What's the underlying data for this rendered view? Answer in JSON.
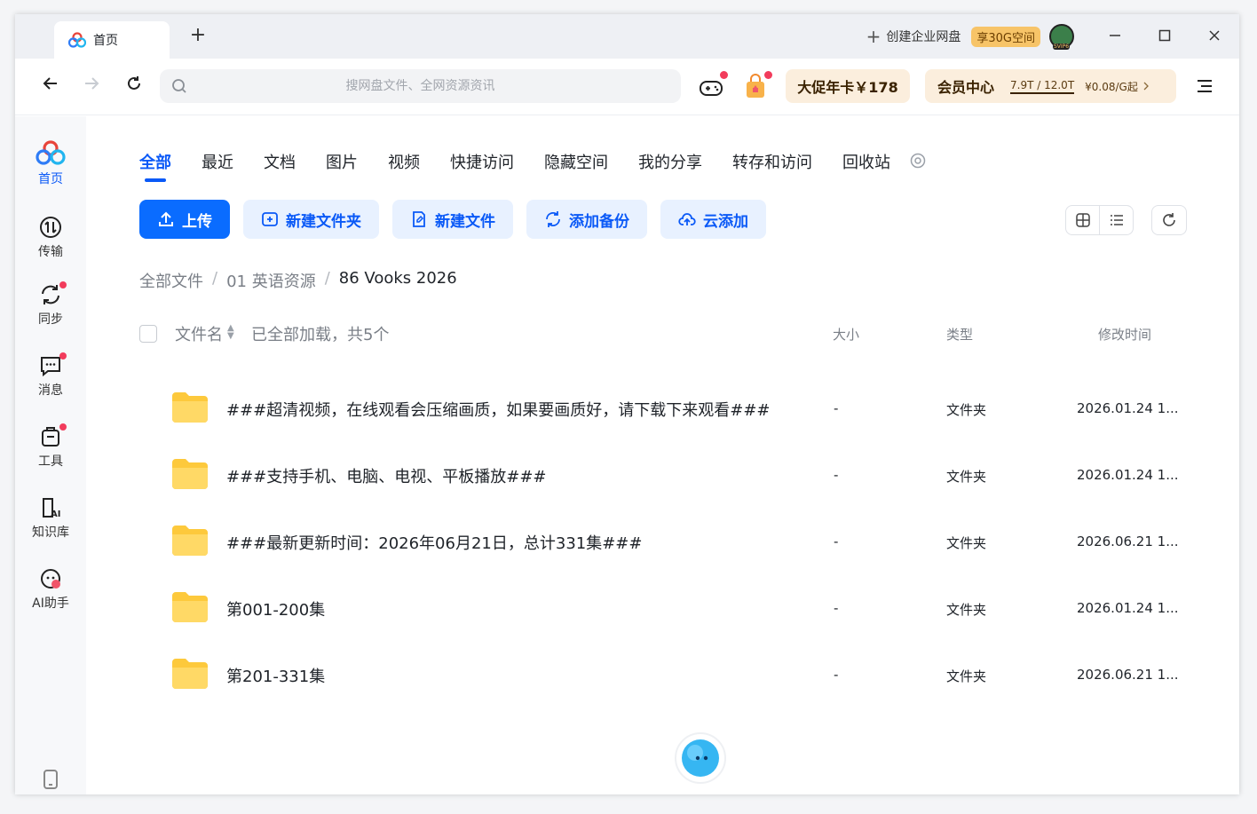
{
  "titlebar": {
    "tab_label": "首页",
    "new_tab": "+",
    "create_enterprise": "创建企业网盘",
    "space_badge": "享30G空间",
    "avatar_label": "SVIP6"
  },
  "toolbar": {
    "search_placeholder": "搜网盘文件、全网资源资讯",
    "promo_label": "大促年卡￥178",
    "vip_title": "会员中心",
    "vip_quota": "7.9T / 12.0T",
    "vip_price": "¥0.08/G起"
  },
  "sidebar": {
    "items": [
      {
        "label": "首页",
        "icon": "logo-icon"
      },
      {
        "label": "传输",
        "icon": "transfer-icon"
      },
      {
        "label": "同步",
        "icon": "sync-icon"
      },
      {
        "label": "消息",
        "icon": "message-icon"
      },
      {
        "label": "工具",
        "icon": "toolbox-icon"
      },
      {
        "label": "知识库",
        "icon": "knowledge-base-icon"
      },
      {
        "label": "AI助手",
        "icon": "ai-assistant-icon"
      }
    ]
  },
  "categories": [
    "全部",
    "最近",
    "文档",
    "图片",
    "视频",
    "快捷访问",
    "隐藏空间",
    "我的分享",
    "转存和访问",
    "回收站"
  ],
  "actions": {
    "upload": "上传",
    "new_folder": "新建文件夹",
    "new_file": "新建文件",
    "add_backup": "添加备份",
    "cloud_add": "云添加"
  },
  "breadcrumb": [
    "全部文件",
    "01 英语资源",
    "86 Vooks 2026"
  ],
  "table": {
    "col_name": "文件名",
    "loaded_status": "已全部加载，共5个",
    "col_size": "大小",
    "col_type": "类型",
    "col_time": "修改时间",
    "rows": [
      {
        "name": "###超清视频，在线观看会压缩画质，如果要画质好，请下载下来观看###",
        "size": "-",
        "type": "文件夹",
        "time": "2026.01.24 1..."
      },
      {
        "name": "###支持手机、电脑、电视、平板播放###",
        "size": "-",
        "type": "文件夹",
        "time": "2026.01.24 1..."
      },
      {
        "name": "###最新更新时间：2026年06月21日，总计331集###",
        "size": "-",
        "type": "文件夹",
        "time": "2026.06.21 1..."
      },
      {
        "name": "第001-200集",
        "size": "-",
        "type": "文件夹",
        "time": "2026.01.24 1..."
      },
      {
        "name": "第201-331集",
        "size": "-",
        "type": "文件夹",
        "time": "2026.06.21 1..."
      }
    ]
  },
  "colors": {
    "accent": "#0a59f7",
    "primary_button": "#0a6cff",
    "folder": "#fdc93c",
    "badge_red": "#f23c5c"
  }
}
